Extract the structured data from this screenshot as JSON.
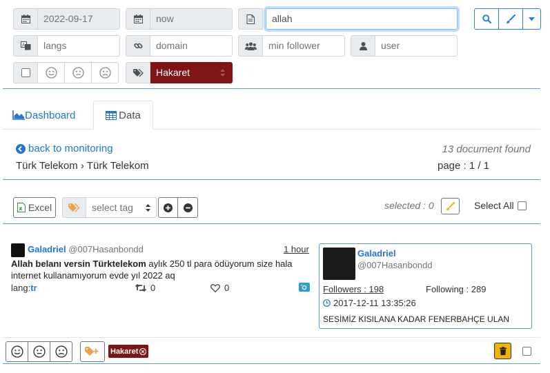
{
  "filters": {
    "date_from": "2022-09-17",
    "date_to": "now",
    "query": "allah",
    "langs_placeholder": "langs",
    "domain_placeholder": "domain",
    "min_follower_placeholder": "min follower",
    "user_placeholder": "user",
    "tag_selected": "Hakaret"
  },
  "tabs": [
    {
      "label": "Dashboard",
      "active": false
    },
    {
      "label": "Data",
      "active": true
    }
  ],
  "nav": {
    "back_link": "back to monitoring",
    "breadcrumb": "Türk Telekom › Türk Telekom",
    "doc_count": "13 document found",
    "page_info": "page : 1 / 1"
  },
  "toolbar": {
    "excel_label": "Excel",
    "select_tag_placeholder": "select tag",
    "selected_text": "selected : 0",
    "select_all_label": "Select All"
  },
  "post": {
    "author_name": "Galadriel",
    "author_handle": "@007Hasanbondd",
    "time_ago": "1 hour",
    "text_bold": "Allah belanı versin Türktelekom",
    "text_rest": " aylık 250 tl para ödüyorum size hala internet kullanamıyorum evde yıl 2022 aq",
    "lang_label": "lang:",
    "lang_value": "tr",
    "retweets": "0",
    "likes": "0",
    "tag_badge": "Hakaret"
  },
  "profile_card": {
    "name": "Galadriel",
    "handle": "@007Hasanbondd",
    "followers": "Followers : 198",
    "following": "Following : 289",
    "joined": "2017-12-11 13:35:26",
    "bio": "SESİMİZ KISILANA KADAR FENERBAHÇE ULAN"
  },
  "colors": {
    "accent": "#2b7de0",
    "tag_red": "#7f1416",
    "divider": "#5aa3c4",
    "orange": "#f0a04b",
    "trash_yellow": "#f0b400"
  }
}
